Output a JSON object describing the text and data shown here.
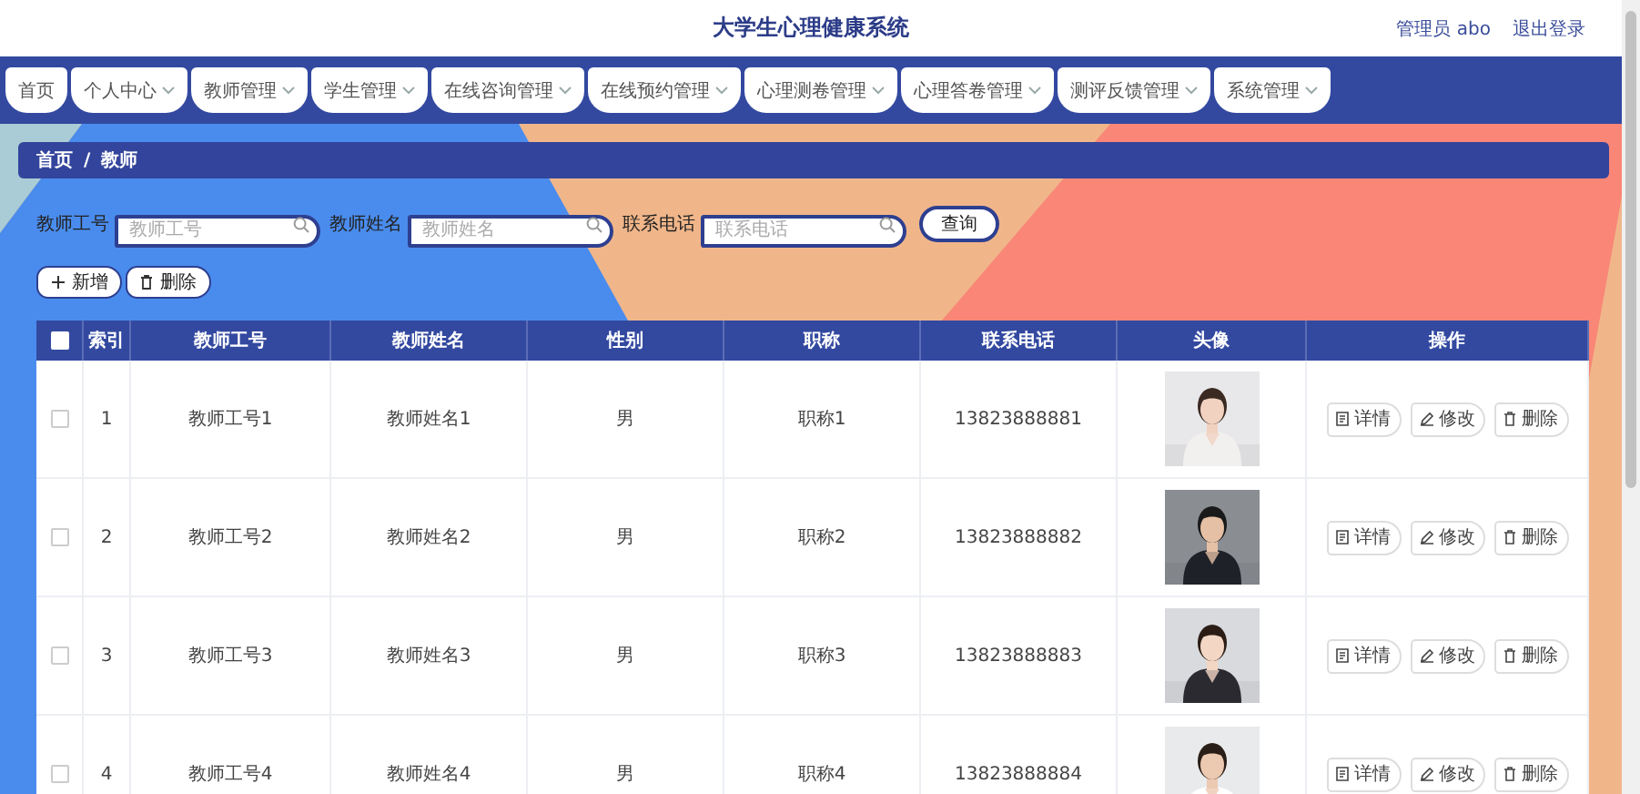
{
  "header": {
    "title": "大学生心理健康系统",
    "user": "管理员 abo",
    "logout": "退出登录"
  },
  "nav": [
    {
      "label": "首页",
      "dropdown": false
    },
    {
      "label": "个人中心",
      "dropdown": true
    },
    {
      "label": "教师管理",
      "dropdown": true
    },
    {
      "label": "学生管理",
      "dropdown": true
    },
    {
      "label": "在线咨询管理",
      "dropdown": true
    },
    {
      "label": "在线预约管理",
      "dropdown": true
    },
    {
      "label": "心理测卷管理",
      "dropdown": true
    },
    {
      "label": "心理答卷管理",
      "dropdown": true
    },
    {
      "label": "测评反馈管理",
      "dropdown": true
    },
    {
      "label": "系统管理",
      "dropdown": true
    }
  ],
  "breadcrumb": {
    "items": [
      "首页",
      "教师"
    ],
    "separator": "/"
  },
  "search": {
    "fields": [
      {
        "label": "教师工号",
        "placeholder": "教师工号"
      },
      {
        "label": "教师姓名",
        "placeholder": "教师姓名"
      },
      {
        "label": "联系电话",
        "placeholder": "联系电话"
      }
    ],
    "button": "查询"
  },
  "actions": [
    {
      "label": "新增",
      "kind": "add"
    },
    {
      "label": "删除",
      "kind": "delete"
    }
  ],
  "table": {
    "select_all": false,
    "columns": [
      "索引",
      "教师工号",
      "教师姓名",
      "性别",
      "职称",
      "联系电话",
      "头像",
      "操作"
    ],
    "rows": [
      {
        "selected": false,
        "index": "1",
        "id": "教师工号1",
        "name": "教师姓名1",
        "gender": "男",
        "title": "职称1",
        "phone": "13823888881",
        "avatar": {
          "kind": "picture"
        },
        "actions": [
          {
            "label": "详情",
            "kind": "detail"
          },
          {
            "label": "修改",
            "kind": "edit"
          },
          {
            "label": "删除",
            "kind": "delete"
          }
        ]
      },
      {
        "selected": false,
        "index": "2",
        "id": "教师工号2",
        "name": "教师姓名2",
        "gender": "男",
        "title": "职称2",
        "phone": "13823888882",
        "avatar": {
          "kind": "picture"
        },
        "actions": [
          {
            "label": "详情",
            "kind": "detail"
          },
          {
            "label": "修改",
            "kind": "edit"
          },
          {
            "label": "删除",
            "kind": "delete"
          }
        ]
      },
      {
        "selected": false,
        "index": "3",
        "id": "教师工号3",
        "name": "教师姓名3",
        "gender": "男",
        "title": "职称3",
        "phone": "13823888883",
        "avatar": {
          "kind": "picture"
        },
        "actions": [
          {
            "label": "详情",
            "kind": "detail"
          },
          {
            "label": "修改",
            "kind": "edit"
          },
          {
            "label": "删除",
            "kind": "delete"
          }
        ]
      },
      {
        "selected": false,
        "index": "4",
        "id": "教师工号4",
        "name": "教师姓名4",
        "gender": "男",
        "title": "职称4",
        "phone": "13823888884",
        "avatar": {
          "kind": "picture"
        },
        "actions": [
          {
            "label": "详情",
            "kind": "detail"
          },
          {
            "label": "修改",
            "kind": "edit"
          },
          {
            "label": "删除",
            "kind": "delete"
          }
        ]
      }
    ]
  }
}
